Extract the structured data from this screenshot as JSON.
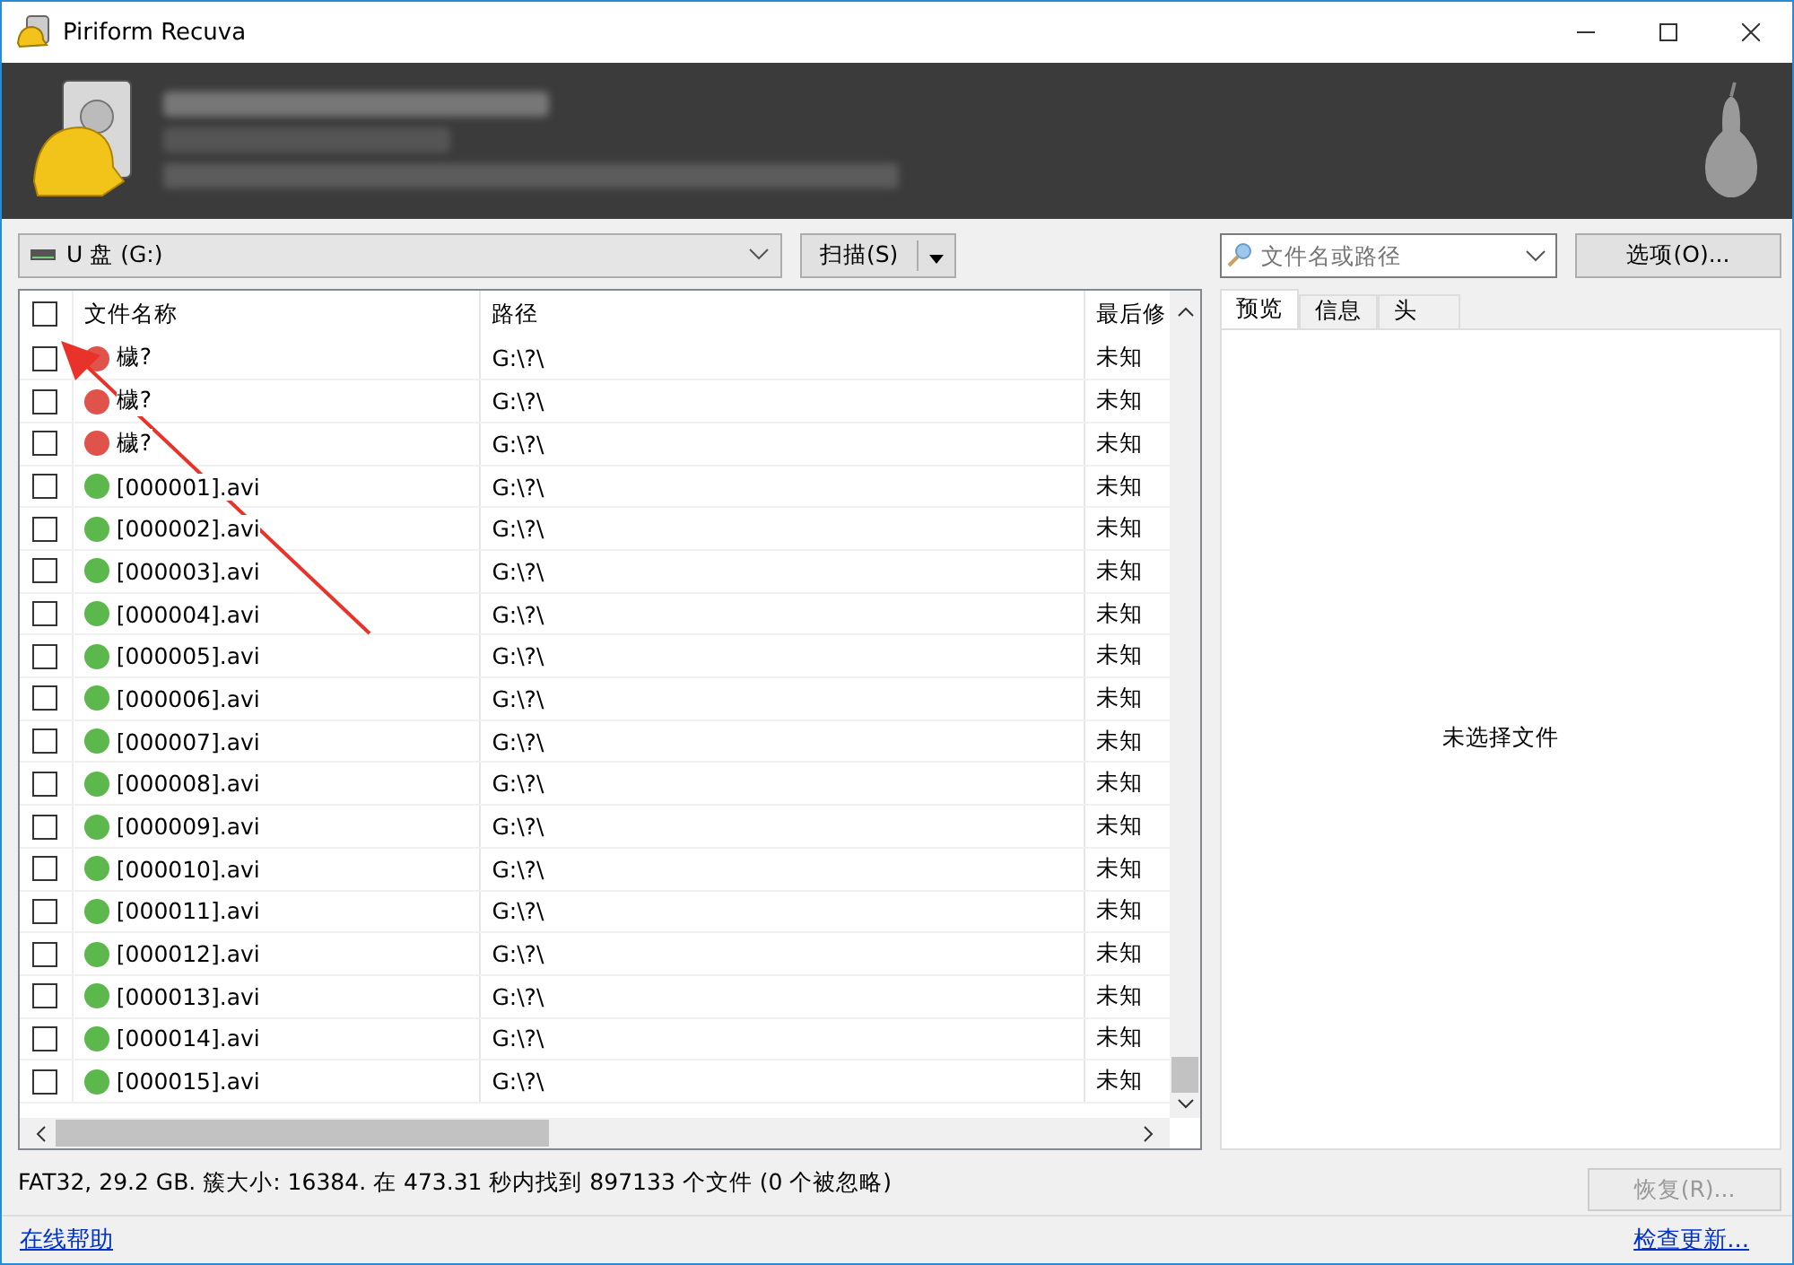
{
  "window": {
    "title": "Piriform Recuva"
  },
  "drive_select": {
    "value": "U 盘 (G:)"
  },
  "scan_button": {
    "label": "扫描(S)"
  },
  "search": {
    "placeholder": "文件名或路径"
  },
  "options_button": {
    "label": "选项(O)..."
  },
  "table": {
    "select_all": {
      "checked": false
    },
    "columns": [
      "文件名称",
      "路径",
      "最后修"
    ],
    "rows": [
      {
        "checked": false,
        "color": "#e0534a",
        "name": "檅?",
        "path": "G:\\?\\",
        "modified": "未知"
      },
      {
        "checked": false,
        "color": "#e0534a",
        "name": "檅?",
        "path": "G:\\?\\",
        "modified": "未知"
      },
      {
        "checked": false,
        "color": "#e0534a",
        "name": "檅?",
        "path": "G:\\?\\",
        "modified": "未知"
      },
      {
        "checked": false,
        "color": "#5cb84c",
        "name": "[000001].avi",
        "path": "G:\\?\\",
        "modified": "未知"
      },
      {
        "checked": false,
        "color": "#5cb84c",
        "name": "[000002].avi",
        "path": "G:\\?\\",
        "modified": "未知"
      },
      {
        "checked": false,
        "color": "#5cb84c",
        "name": "[000003].avi",
        "path": "G:\\?\\",
        "modified": "未知"
      },
      {
        "checked": false,
        "color": "#5cb84c",
        "name": "[000004].avi",
        "path": "G:\\?\\",
        "modified": "未知"
      },
      {
        "checked": false,
        "color": "#5cb84c",
        "name": "[000005].avi",
        "path": "G:\\?\\",
        "modified": "未知"
      },
      {
        "checked": false,
        "color": "#5cb84c",
        "name": "[000006].avi",
        "path": "G:\\?\\",
        "modified": "未知"
      },
      {
        "checked": false,
        "color": "#5cb84c",
        "name": "[000007].avi",
        "path": "G:\\?\\",
        "modified": "未知"
      },
      {
        "checked": false,
        "color": "#5cb84c",
        "name": "[000008].avi",
        "path": "G:\\?\\",
        "modified": "未知"
      },
      {
        "checked": false,
        "color": "#5cb84c",
        "name": "[000009].avi",
        "path": "G:\\?\\",
        "modified": "未知"
      },
      {
        "checked": false,
        "color": "#5cb84c",
        "name": "[000010].avi",
        "path": "G:\\?\\",
        "modified": "未知"
      },
      {
        "checked": false,
        "color": "#5cb84c",
        "name": "[000011].avi",
        "path": "G:\\?\\",
        "modified": "未知"
      },
      {
        "checked": false,
        "color": "#5cb84c",
        "name": "[000012].avi",
        "path": "G:\\?\\",
        "modified": "未知"
      },
      {
        "checked": false,
        "color": "#5cb84c",
        "name": "[000013].avi",
        "path": "G:\\?\\",
        "modified": "未知"
      },
      {
        "checked": false,
        "color": "#5cb84c",
        "name": "[000014].avi",
        "path": "G:\\?\\",
        "modified": "未知"
      },
      {
        "checked": false,
        "color": "#5cb84c",
        "name": "[000015].avi",
        "path": "G:\\?\\",
        "modified": "未知"
      }
    ]
  },
  "preview_tabs": [
    {
      "label": "预览",
      "selected": true
    },
    {
      "label": "信息",
      "selected": false
    },
    {
      "label": "头",
      "selected": false
    }
  ],
  "preview": {
    "message": "未选择文件"
  },
  "status_bar": {
    "text": "FAT32, 29.2 GB. 簇大小: 16384. 在 473.31 秒内找到 897133 个文件 (0 个被忽略)"
  },
  "restore_button": {
    "label": "恢复(R)...",
    "disabled": true
  },
  "footer": {
    "help_link": "在线帮助",
    "update_link": "检查更新..."
  }
}
